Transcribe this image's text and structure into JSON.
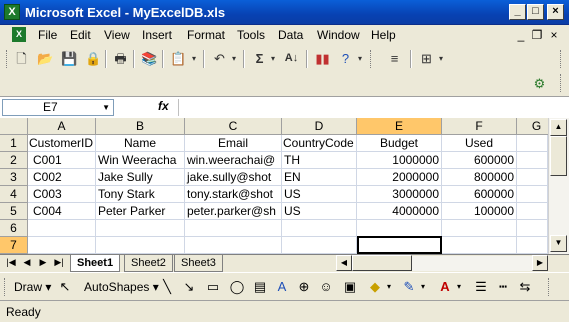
{
  "window": {
    "title": "Microsoft Excel - MyExcelDB.xls",
    "app_icon": "excel-icon"
  },
  "menu": {
    "items": [
      "File",
      "Edit",
      "View",
      "Insert",
      "Format",
      "Tools",
      "Data",
      "Window",
      "Help"
    ]
  },
  "formula": {
    "name_box": "E7",
    "fx_label": "fx",
    "value": ""
  },
  "sheet": {
    "columns": [
      "A",
      "B",
      "C",
      "D",
      "E",
      "F",
      "G"
    ],
    "rows": [
      "1",
      "2",
      "3",
      "4",
      "5",
      "6",
      "7"
    ],
    "header_row": [
      "CustomerID",
      "Name",
      "Email",
      "CountryCode",
      "Budget",
      "Used"
    ],
    "data": [
      [
        "C001",
        "Win Weeracha",
        "win.weerachai@",
        "TH",
        "1000000",
        "600000"
      ],
      [
        "C002",
        "Jake Sully",
        "jake.sully@shot",
        "EN",
        "2000000",
        "800000"
      ],
      [
        "C003",
        "Tony Stark",
        "tony.stark@shot",
        "US",
        "3000000",
        "600000"
      ],
      [
        "C004",
        "Peter Parker",
        "peter.parker@sh",
        "US",
        "4000000",
        "100000"
      ]
    ],
    "selected_cell": "E7"
  },
  "tabs": [
    "Sheet1",
    "Sheet2",
    "Sheet3"
  ],
  "active_tab": "Sheet1",
  "drawing": {
    "draw_label": "Draw ▾",
    "autoshapes_label": "AutoShapes ▾"
  },
  "status": {
    "text": "Ready"
  },
  "colors": {
    "title_bar": "#0842b3",
    "selection_header": "#ffc76a",
    "grid_line": "#d0d7e5"
  }
}
